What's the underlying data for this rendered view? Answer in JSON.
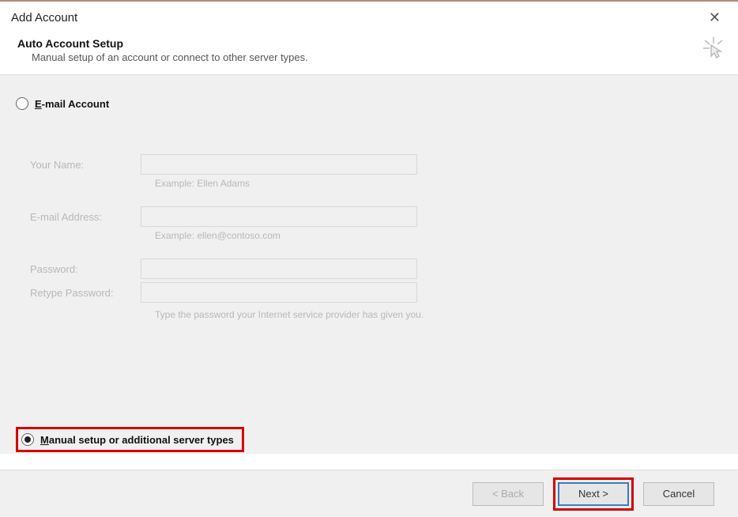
{
  "window": {
    "title": "Add Account"
  },
  "header": {
    "title": "Auto Account Setup",
    "subtitle": "Manual setup of an account or connect to other server types."
  },
  "options": {
    "email_account_label": "E-mail Account",
    "manual_setup_label": "Manual setup or additional server types"
  },
  "form": {
    "name_label": "Your Name:",
    "name_value": "",
    "name_hint": "Example: Ellen Adams",
    "email_label": "E-mail Address:",
    "email_value": "",
    "email_hint": "Example: ellen@contoso.com",
    "password_label": "Password:",
    "password_value": "",
    "retype_label": "Retype Password:",
    "retype_value": "",
    "password_hint": "Type the password your Internet service provider has given you."
  },
  "buttons": {
    "back": "< Back",
    "next": "Next >",
    "cancel": "Cancel"
  }
}
